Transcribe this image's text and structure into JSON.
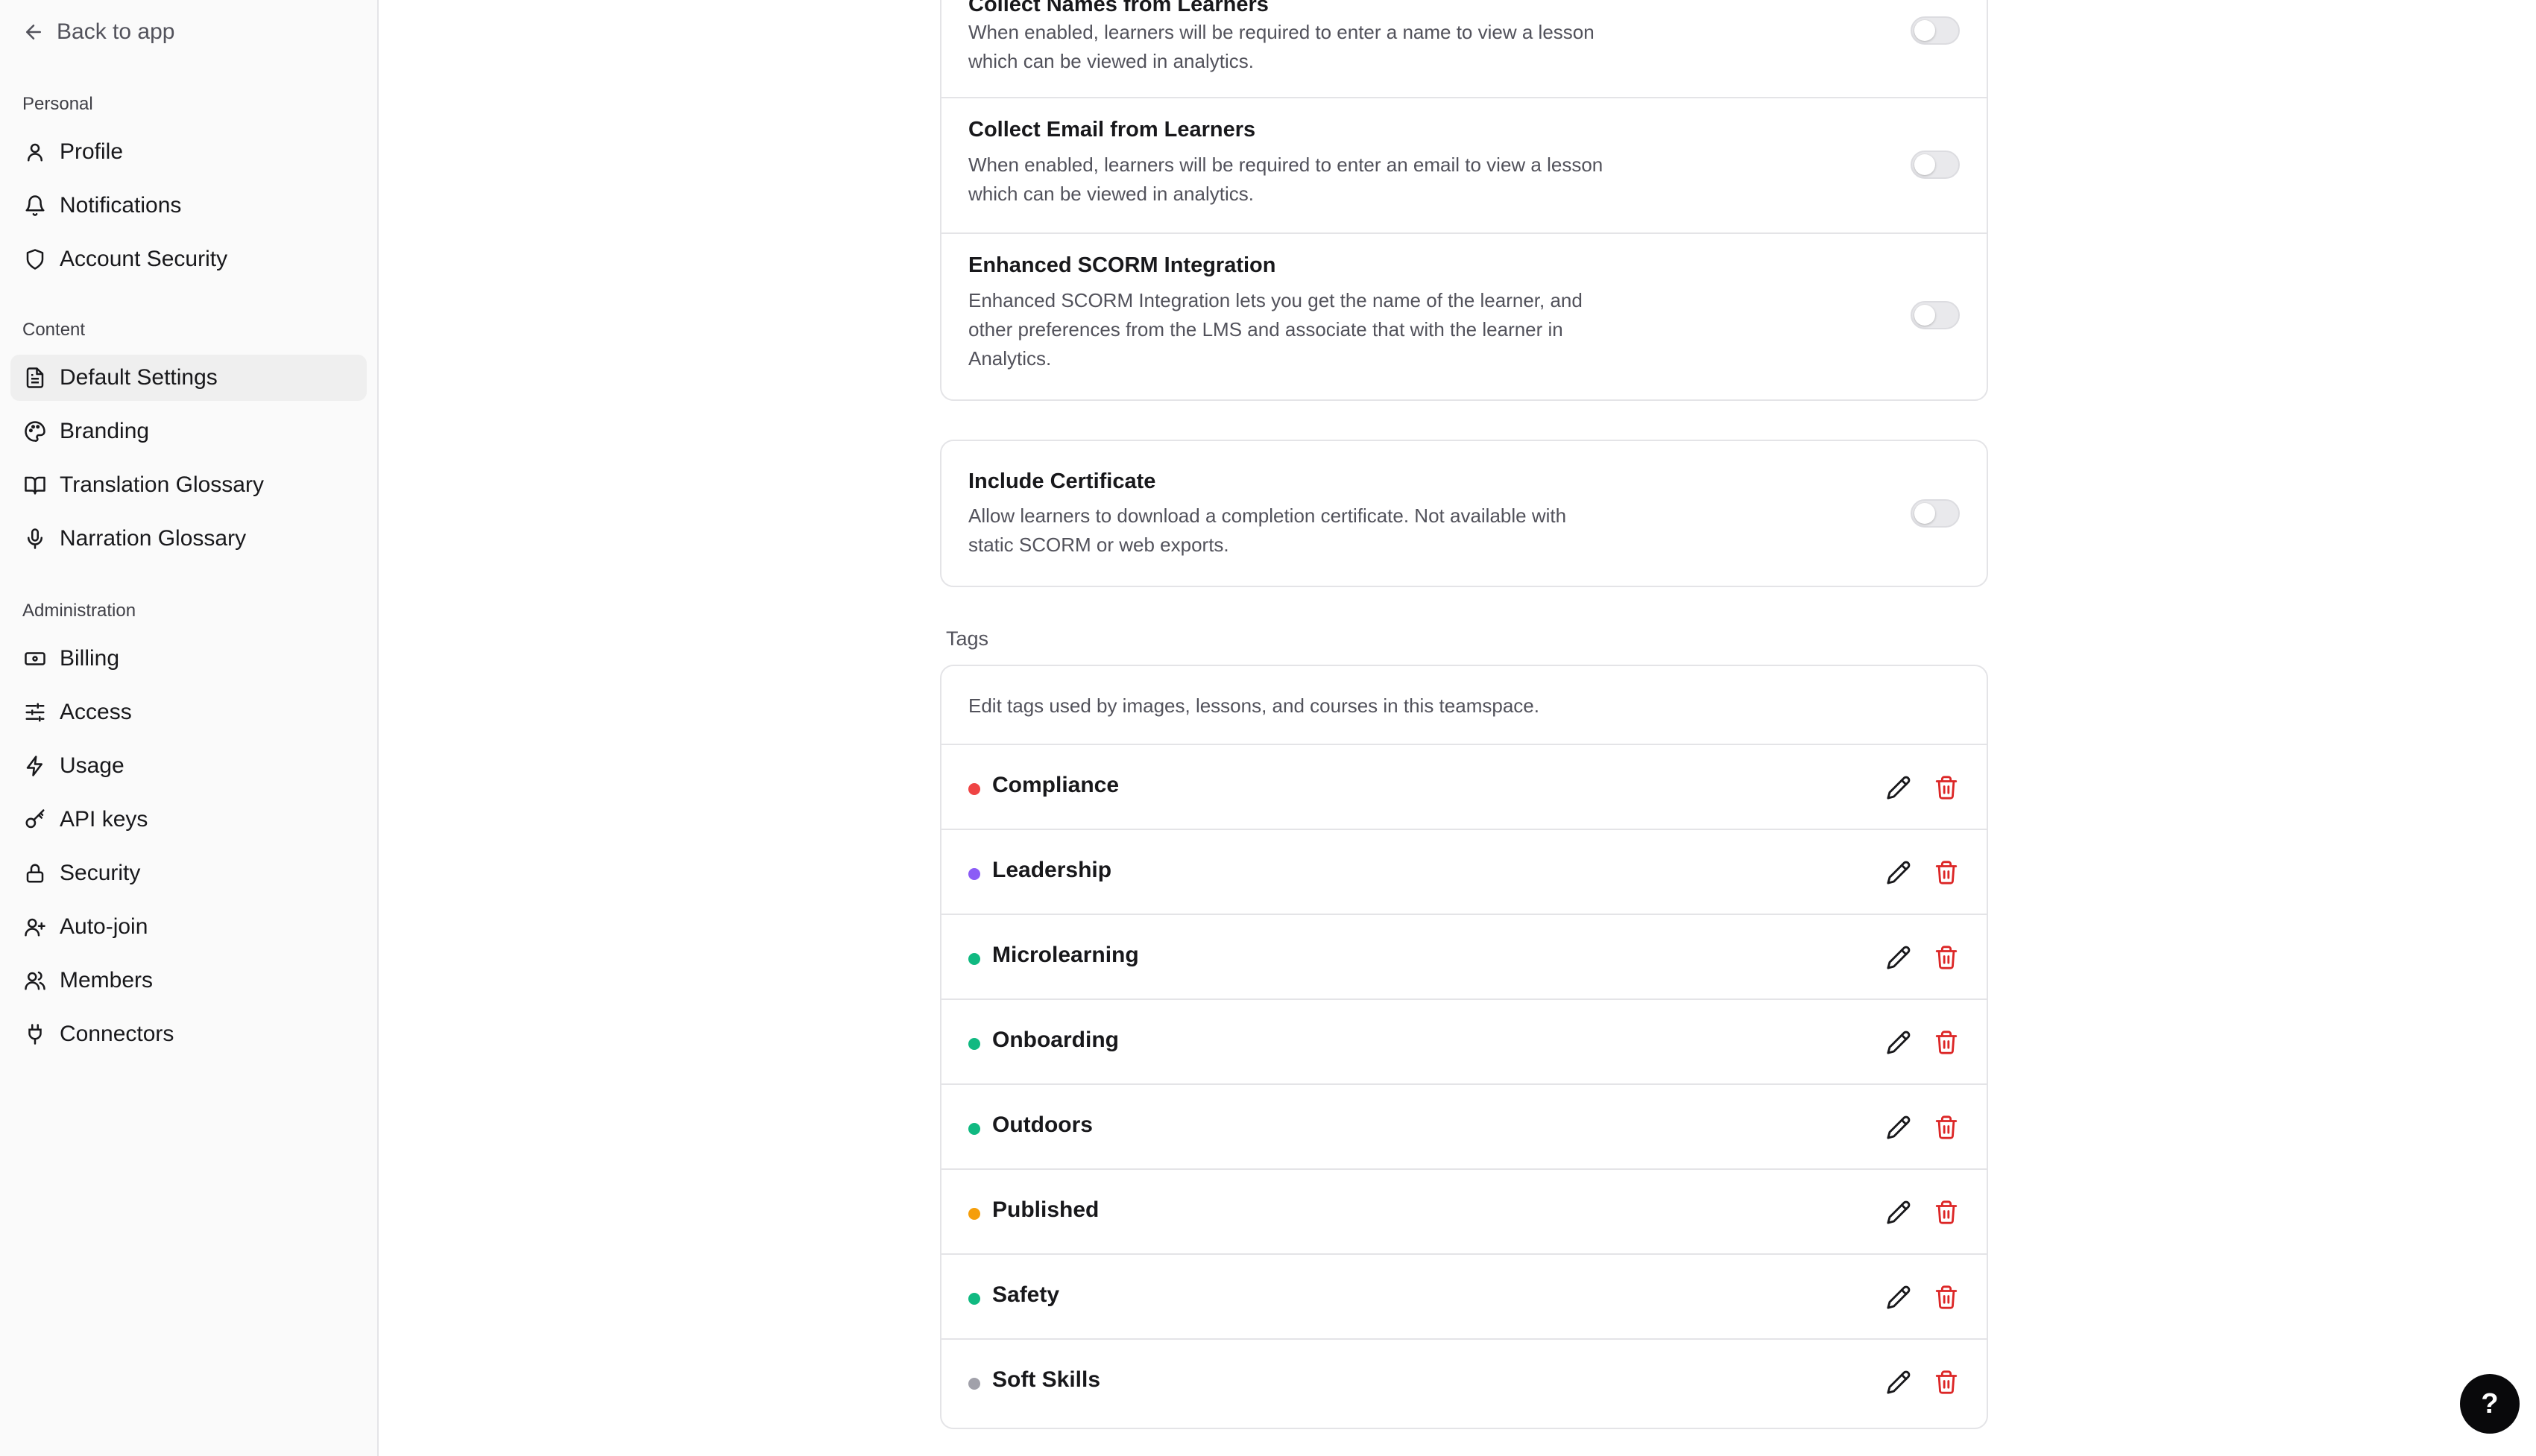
{
  "sidebar": {
    "back_label": "Back to app",
    "groups": [
      {
        "label": "Personal"
      },
      {
        "label": "Content"
      },
      {
        "label": "Administration"
      }
    ],
    "items": [
      {
        "label": "Profile",
        "icon": "user-icon"
      },
      {
        "label": "Notifications",
        "icon": "bell-icon"
      },
      {
        "label": "Account Security",
        "icon": "shield-icon"
      },
      {
        "label": "Default Settings",
        "icon": "document-icon",
        "active": true
      },
      {
        "label": "Branding",
        "icon": "palette-icon"
      },
      {
        "label": "Translation Glossary",
        "icon": "book-icon"
      },
      {
        "label": "Narration Glossary",
        "icon": "microphone-icon"
      },
      {
        "label": "Billing",
        "icon": "banknote-icon"
      },
      {
        "label": "Access",
        "icon": "sliders-icon"
      },
      {
        "label": "Usage",
        "icon": "zap-icon"
      },
      {
        "label": "API keys",
        "icon": "key-icon"
      },
      {
        "label": "Security",
        "icon": "lock-icon"
      },
      {
        "label": "Auto-join",
        "icon": "user-plus-icon"
      },
      {
        "label": "Members",
        "icon": "users-icon"
      },
      {
        "label": "Connectors",
        "icon": "plug-icon"
      }
    ]
  },
  "settings": [
    {
      "title": "Collect Names from Learners",
      "desc": "When enabled, learners will be required to enter a name to view a lesson which can be viewed in analytics.",
      "enabled": false
    },
    {
      "title": "Collect Email from Learners",
      "desc": "When enabled, learners will be required to enter an email to view a lesson which can be viewed in analytics.",
      "enabled": false
    },
    {
      "title": "Enhanced SCORM Integration",
      "desc": "Enhanced SCORM Integration lets you get the name of the learner, and other preferences from the LMS and associate that with the learner in Analytics.",
      "enabled": false
    }
  ],
  "certificate": {
    "title": "Include Certificate",
    "desc": "Allow learners to download a completion certificate. Not available with static SCORM or web exports.",
    "enabled": false
  },
  "tags": {
    "section_label": "Tags",
    "description": "Edit tags used by images, lessons, and courses in this teamspace.",
    "items": [
      {
        "name": "Compliance",
        "color": "#ef4444"
      },
      {
        "name": "Leadership",
        "color": "#8b5cf6"
      },
      {
        "name": "Microlearning",
        "color": "#10b981"
      },
      {
        "name": "Onboarding",
        "color": "#10b981"
      },
      {
        "name": "Outdoors",
        "color": "#10b981"
      },
      {
        "name": "Published",
        "color": "#f59e0b"
      },
      {
        "name": "Safety",
        "color": "#10b981"
      },
      {
        "name": "Soft Skills",
        "color": "#a1a1aa"
      }
    ],
    "edit_icon": "pencil-icon",
    "delete_icon": "trash-icon",
    "delete_color": "#dc2626"
  },
  "help": {
    "label": "?"
  }
}
